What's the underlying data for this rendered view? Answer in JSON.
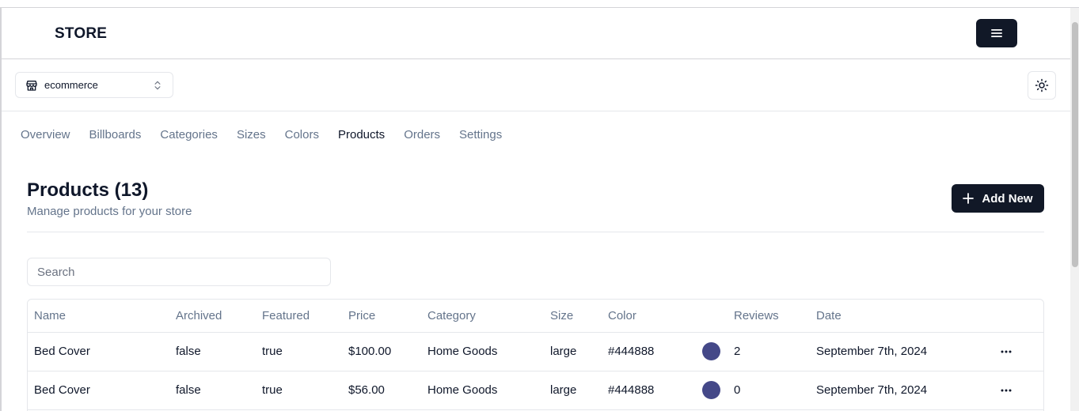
{
  "header": {
    "logo": "STORE"
  },
  "store_switcher": {
    "current": "ecommerce"
  },
  "nav": {
    "items": [
      {
        "label": "Overview",
        "active": false
      },
      {
        "label": "Billboards",
        "active": false
      },
      {
        "label": "Categories",
        "active": false
      },
      {
        "label": "Sizes",
        "active": false
      },
      {
        "label": "Colors",
        "active": false
      },
      {
        "label": "Products",
        "active": true
      },
      {
        "label": "Orders",
        "active": false
      },
      {
        "label": "Settings",
        "active": false
      }
    ]
  },
  "page": {
    "title": "Products (13)",
    "subtitle": "Manage products for your store",
    "add_label": "Add New"
  },
  "search": {
    "placeholder": "Search",
    "value": ""
  },
  "table": {
    "columns": [
      "Name",
      "Archived",
      "Featured",
      "Price",
      "Category",
      "Size",
      "Color",
      "",
      "Reviews",
      "Date",
      ""
    ],
    "rows": [
      {
        "name": "Bed Cover",
        "archived": "false",
        "featured": "true",
        "price": "$100.00",
        "category": "Home Goods",
        "size": "large",
        "color": "#444888",
        "reviews": "2",
        "date": "September 7th, 2024"
      },
      {
        "name": "Bed Cover",
        "archived": "false",
        "featured": "true",
        "price": "$56.00",
        "category": "Home Goods",
        "size": "large",
        "color": "#444888",
        "reviews": "0",
        "date": "September 7th, 2024"
      }
    ]
  },
  "colors": {
    "primary": "#111827",
    "muted_text": "#64748b",
    "border": "#e5e7eb"
  },
  "icons": {
    "menu": "hamburger-icon",
    "store": "store-icon",
    "switch": "chevrons-up-down-icon",
    "theme": "sun-icon",
    "add": "plus-icon",
    "row_actions": "more-horizontal-icon"
  }
}
